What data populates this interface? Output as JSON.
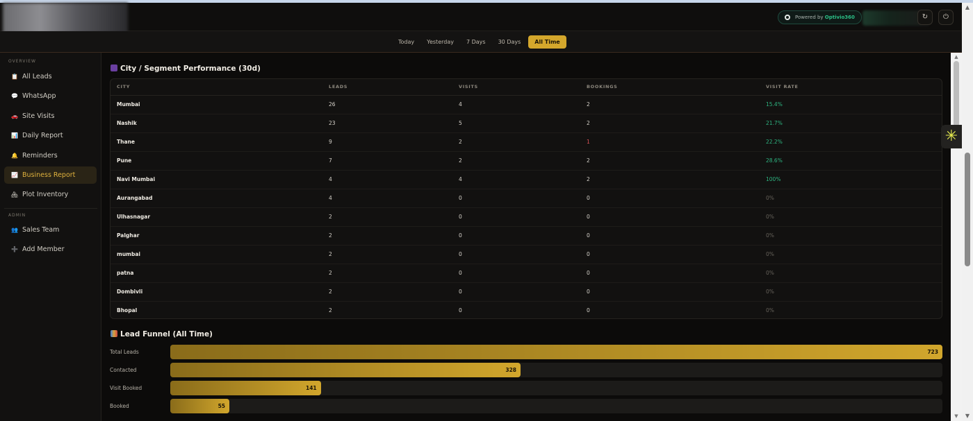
{
  "header": {
    "powered_prefix": "Powered by ",
    "powered_brand": "Optivio360",
    "refresh_icon": "refresh-icon",
    "power_icon": "power-icon"
  },
  "date_filters": {
    "options": [
      "Today",
      "Yesterday",
      "7 Days",
      "30 Days",
      "All Time"
    ],
    "selected": "All Time"
  },
  "sidebar": {
    "overview_label": "OVERVIEW",
    "admin_label": "ADMIN",
    "items": [
      {
        "label": "All Leads",
        "icon": "clipboard-icon",
        "glyph": "📋"
      },
      {
        "label": "WhatsApp",
        "icon": "chat-bubble-icon",
        "glyph": "💬"
      },
      {
        "label": "Site Visits",
        "icon": "car-icon",
        "glyph": "🚗"
      },
      {
        "label": "Daily Report",
        "icon": "bar-chart-icon",
        "glyph": "📊"
      },
      {
        "label": "Reminders",
        "icon": "bell-icon",
        "glyph": "🔔"
      },
      {
        "label": "Business Report",
        "icon": "trend-chart-icon",
        "glyph": "📈",
        "active": true
      },
      {
        "label": "Plot Inventory",
        "icon": "house-icon",
        "glyph": "🏘"
      }
    ],
    "admin_items": [
      {
        "label": "Sales Team",
        "icon": "people-icon",
        "glyph": "👥"
      },
      {
        "label": "Add Member",
        "icon": "plus-icon",
        "glyph": "➕"
      }
    ]
  },
  "city_table": {
    "title": "City / Segment Performance (30d)",
    "columns": [
      "CITY",
      "LEADS",
      "VISITS",
      "BOOKINGS",
      "VISIT RATE"
    ],
    "rows": [
      [
        "Mumbai",
        "26",
        "4",
        "2",
        "15.4%"
      ],
      [
        "Nashik",
        "23",
        "5",
        "2",
        "21.7%"
      ],
      [
        "Thane",
        "9",
        "2",
        "1",
        "22.2%"
      ],
      [
        "Pune",
        "7",
        "2",
        "2",
        "28.6%"
      ],
      [
        "Navi Mumbai",
        "4",
        "4",
        "2",
        "100%"
      ],
      [
        "Aurangabad",
        "4",
        "0",
        "0",
        "0%"
      ],
      [
        "Ulhasnagar",
        "2",
        "0",
        "0",
        "0%"
      ],
      [
        "Palghar",
        "2",
        "0",
        "0",
        "0%"
      ],
      [
        "mumbai",
        "2",
        "0",
        "0",
        "0%"
      ],
      [
        "patna",
        "2",
        "0",
        "0",
        "0%"
      ],
      [
        "Dombivli",
        "2",
        "0",
        "0",
        "0%"
      ],
      [
        "Bhopal",
        "2",
        "0",
        "0",
        "0%"
      ]
    ]
  },
  "funnel": {
    "title": "Lead Funnel (All Time)",
    "stages": [
      {
        "label": "Total Leads",
        "value": 723
      },
      {
        "label": "Contacted",
        "value": 328
      },
      {
        "label": "Visit Booked",
        "value": 141
      },
      {
        "label": "Booked",
        "value": 55
      }
    ]
  },
  "floating_widget_icon": "asterisk-icon",
  "colors": {
    "accent": "#d4a72c",
    "positive": "#2eb581",
    "negative": "#e0545a"
  }
}
